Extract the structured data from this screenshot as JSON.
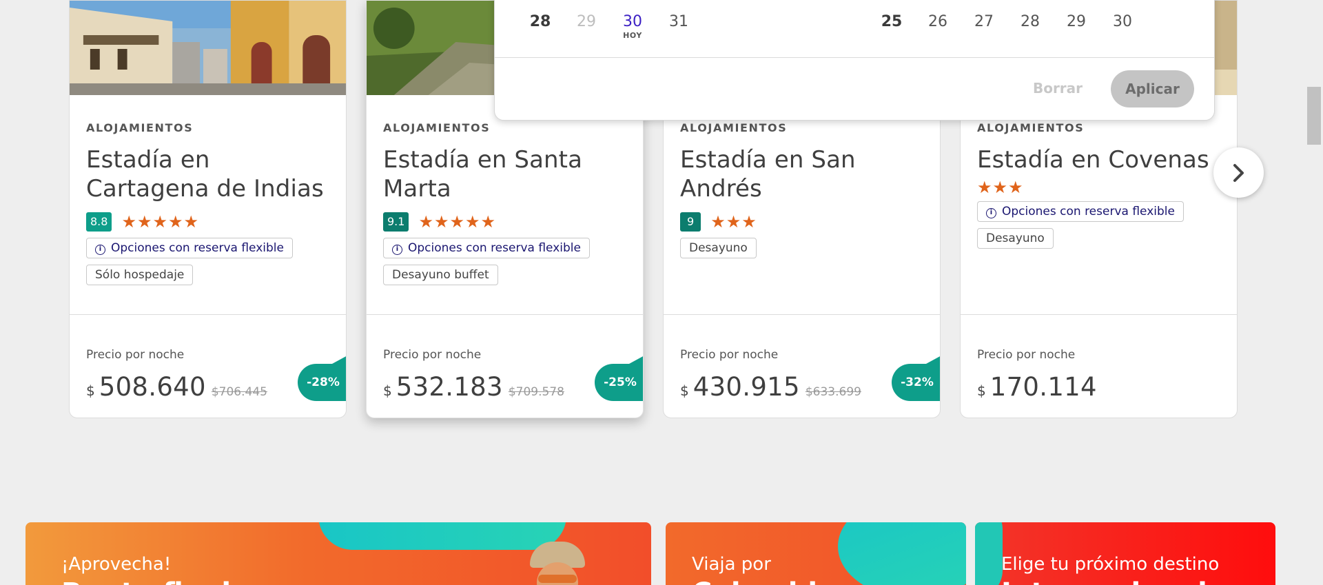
{
  "cards": [
    {
      "category": "ALOJAMIENTOS",
      "title": "Estadía en Cartagena de Indias",
      "score": "8.8",
      "stars": "★★★★★",
      "flex_label": "Opciones con reserva flexible",
      "board": "Sólo hospedaje",
      "price_label": "Precio por noche",
      "currency": "$",
      "price": "508.640",
      "old_price": "$706.445",
      "discount": "-28%"
    },
    {
      "category": "ALOJAMIENTOS",
      "title": "Estadía en Santa Marta",
      "score": "9.1",
      "stars": "★★★★★",
      "flex_label": "Opciones con reserva flexible",
      "board": "Desayuno buffet",
      "price_label": "Precio por noche",
      "currency": "$",
      "price": "532.183",
      "old_price": "$709.578",
      "discount": "-25%"
    },
    {
      "category": "ALOJAMIENTOS",
      "title": "Estadía en San Andrés",
      "score": "9",
      "stars": "★★★",
      "board": "Desayuno",
      "price_label": "Precio por noche",
      "currency": "$",
      "price": "430.915",
      "old_price": "$633.699",
      "discount": "-32%"
    },
    {
      "category": "ALOJAMIENTOS",
      "title": "Estadía en Covenas",
      "stars": "★★★",
      "flex_label": "Opciones con reserva flexible",
      "board": "Desayuno",
      "price_label": "Precio por noche",
      "currency": "$",
      "price": "170.114"
    }
  ],
  "calendar": {
    "left_days": [
      "28",
      "29",
      "30",
      "31"
    ],
    "today_label": "HOY",
    "right_days": [
      "25",
      "26",
      "27",
      "28",
      "29",
      "30"
    ],
    "clear_label": "Borrar",
    "apply_label": "Aplicar"
  },
  "banners": [
    {
      "small": "¡Aprovecha!",
      "big": "Ronto final"
    },
    {
      "small": "Viaja por",
      "big": "Colombia"
    },
    {
      "small": "Elige tu próximo destino",
      "big": "Internacional"
    }
  ],
  "colors": {
    "accent_teal": "#0e9e8a",
    "star_orange": "#e0641b",
    "flex_text": "#1a1670",
    "today_purple": "#3d21c4"
  }
}
